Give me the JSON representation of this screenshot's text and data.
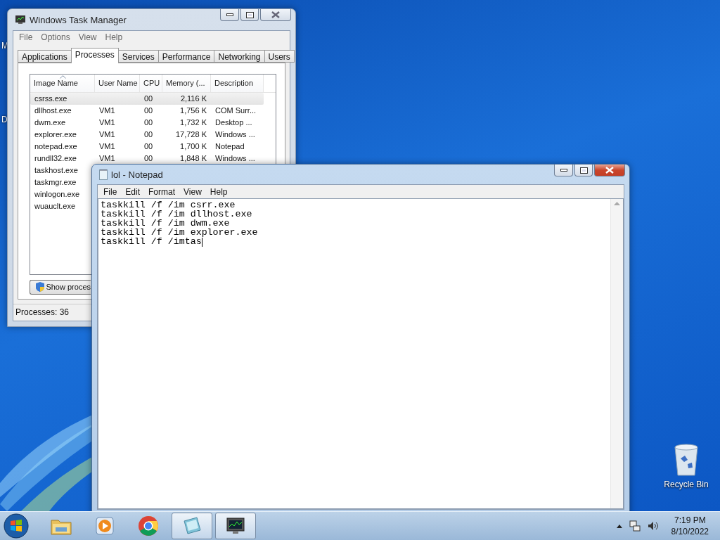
{
  "desktop": {
    "edge_labels": [
      "M",
      "D"
    ],
    "icons": [
      {
        "label": "Recycle Bin"
      }
    ]
  },
  "task_manager": {
    "title": "Windows Task Manager",
    "menu": [
      "File",
      "Options",
      "View",
      "Help"
    ],
    "tabs": [
      {
        "label": "Applications",
        "selected": false
      },
      {
        "label": "Processes",
        "selected": true
      },
      {
        "label": "Services",
        "selected": false
      },
      {
        "label": "Performance",
        "selected": false
      },
      {
        "label": "Networking",
        "selected": false
      },
      {
        "label": "Users",
        "selected": false
      }
    ],
    "columns": [
      {
        "label": "Image Name",
        "sorted": true
      },
      {
        "label": "User Name",
        "sorted": false
      },
      {
        "label": "CPU",
        "sorted": false
      },
      {
        "label": "Memory (...",
        "sorted": false
      },
      {
        "label": "Description",
        "sorted": false
      }
    ],
    "rows": [
      {
        "cells": [
          "csrss.exe",
          "",
          "00",
          "2,116 K",
          ""
        ],
        "selected": true
      },
      {
        "cells": [
          "dllhost.exe",
          "VM1",
          "00",
          "1,756 K",
          "COM Surr..."
        ],
        "selected": false
      },
      {
        "cells": [
          "dwm.exe",
          "VM1",
          "00",
          "1,732 K",
          "Desktop ..."
        ],
        "selected": false
      },
      {
        "cells": [
          "explorer.exe",
          "VM1",
          "00",
          "17,728 K",
          "Windows ..."
        ],
        "selected": false
      },
      {
        "cells": [
          "notepad.exe",
          "VM1",
          "00",
          "1,700 K",
          "Notepad"
        ],
        "selected": false
      },
      {
        "cells": [
          "rundll32.exe",
          "VM1",
          "00",
          "1,848 K",
          "Windows ..."
        ],
        "selected": false
      },
      {
        "cells": [
          "taskhost.exe"
        ],
        "selected": false
      },
      {
        "cells": [
          "taskmgr.exe"
        ],
        "selected": false
      },
      {
        "cells": [
          "winlogon.exe"
        ],
        "selected": false
      },
      {
        "cells": [
          "wuauclt.exe"
        ],
        "selected": false
      }
    ],
    "button": "Show proces",
    "status": "Processes: 36"
  },
  "notepad": {
    "title": "lol - Notepad",
    "menu": [
      "File",
      "Edit",
      "Format",
      "View",
      "Help"
    ],
    "lines": [
      "taskkill /f /im csrr.exe",
      "taskkill /f /im dllhost.exe",
      "taskkill /f /im dwm.exe",
      "taskkill /f /im explorer.exe",
      "taskkill /f /imtas"
    ]
  },
  "taskbar": {
    "items": [
      {
        "kind": "explorer",
        "active": false
      },
      {
        "kind": "media",
        "active": false
      },
      {
        "kind": "browser",
        "active": false
      },
      {
        "kind": "notepad",
        "active": true
      },
      {
        "kind": "taskmgr",
        "active": true
      }
    ],
    "time": "7:19 PM",
    "date": "8/10/2022"
  }
}
